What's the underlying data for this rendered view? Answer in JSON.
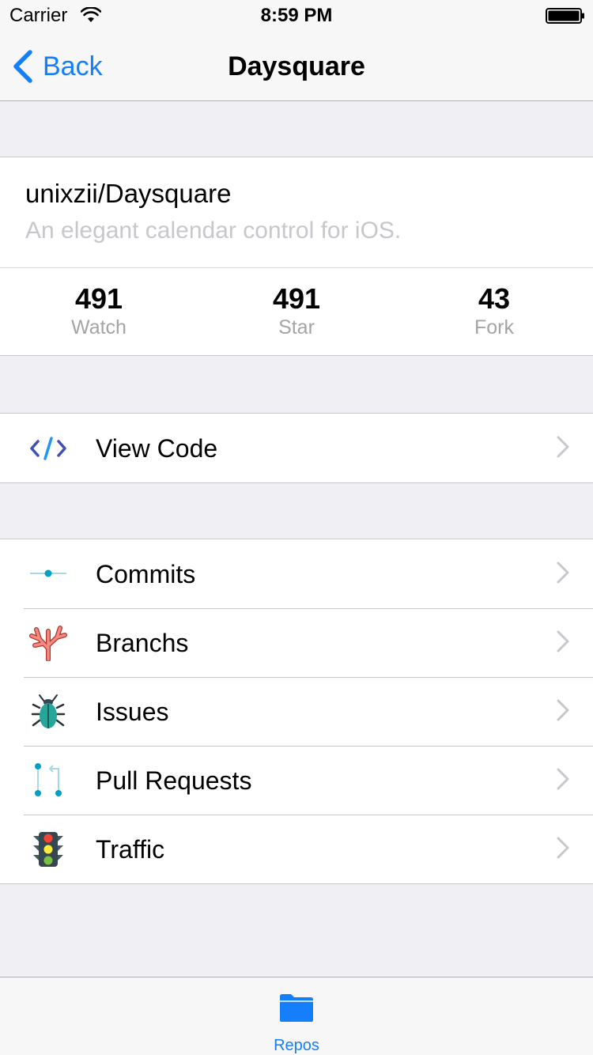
{
  "status_bar": {
    "carrier": "Carrier",
    "time": "8:59 PM"
  },
  "nav": {
    "back_label": "Back",
    "title": "Daysquare"
  },
  "repo": {
    "full_name": "unixzii/Daysquare",
    "description": "An elegant calendar control for iOS.",
    "stats": [
      {
        "value": "491",
        "label": "Watch"
      },
      {
        "value": "491",
        "label": "Star"
      },
      {
        "value": "43",
        "label": "Fork"
      }
    ]
  },
  "code_section": {
    "items": [
      {
        "label": "View Code",
        "icon": "code-icon"
      }
    ]
  },
  "menu_section": {
    "items": [
      {
        "label": "Commits",
        "icon": "commit-icon"
      },
      {
        "label": "Branchs",
        "icon": "branch-coral-icon"
      },
      {
        "label": "Issues",
        "icon": "bug-icon"
      },
      {
        "label": "Pull Requests",
        "icon": "pull-request-icon"
      },
      {
        "label": "Traffic",
        "icon": "traffic-light-icon"
      }
    ]
  },
  "tab_bar": {
    "items": [
      {
        "label": "Repos",
        "icon": "folder-icon",
        "active": true
      }
    ]
  },
  "colors": {
    "accent": "#157efb",
    "background": "#efeff4",
    "secondary_text": "#c7c7cc"
  }
}
